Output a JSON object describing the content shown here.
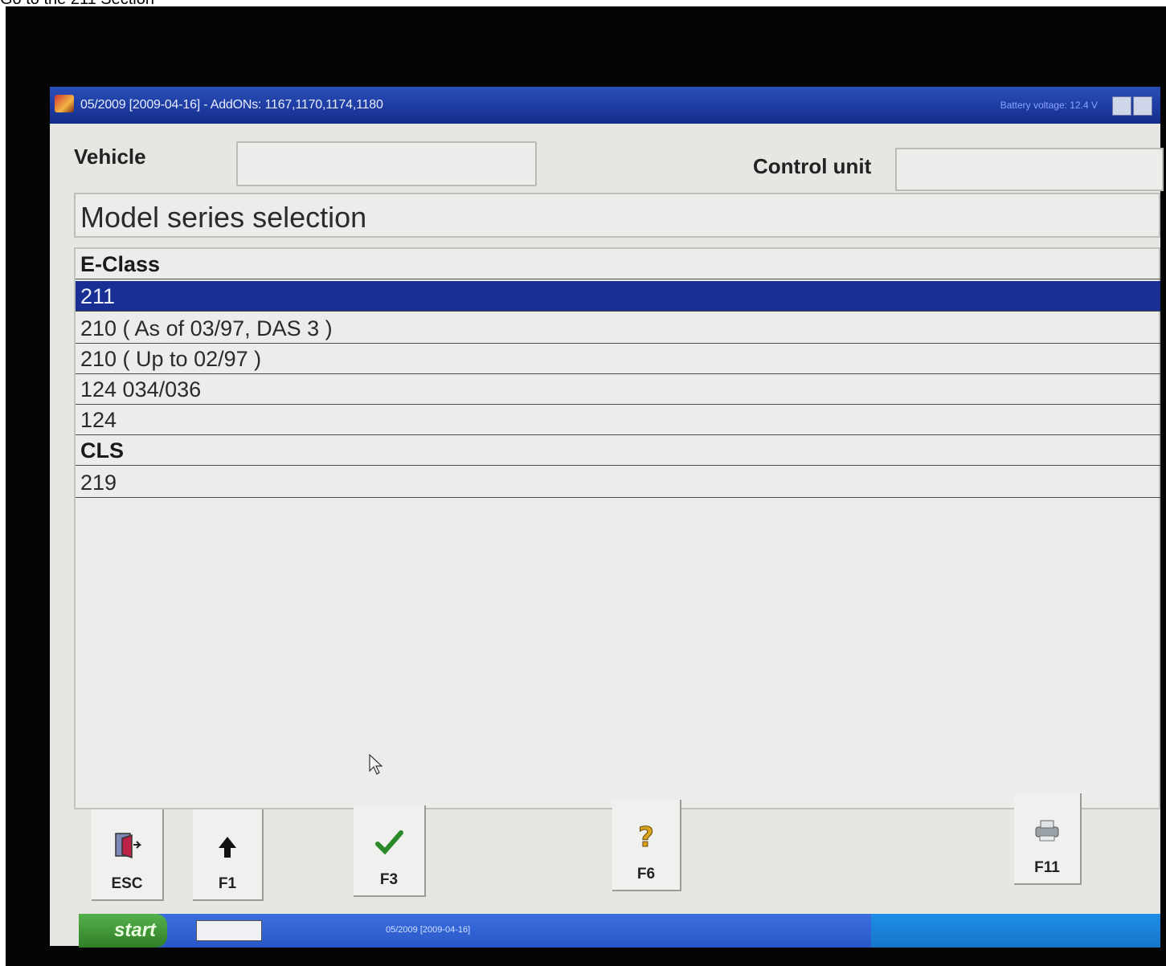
{
  "caption": "Go to the 211 Section",
  "window": {
    "title": "05/2009 [2009-04-16] - AddONs: 1167,1170,1174,1180",
    "battery_text": "Battery voltage: 12.4 V"
  },
  "header": {
    "vehicle_label": "Vehicle",
    "vehicle_value": "",
    "control_unit_label": "Control unit",
    "control_unit_value": ""
  },
  "section_title": "Model series selection",
  "list": {
    "rows": [
      {
        "label": "E-Class",
        "type": "group"
      },
      {
        "label": "211",
        "type": "item",
        "selected": true
      },
      {
        "label": "210 ( As of 03/97, DAS 3 )",
        "type": "item"
      },
      {
        "label": "210 ( Up to 02/97 )",
        "type": "item"
      },
      {
        "label": "124 034/036",
        "type": "item"
      },
      {
        "label": "124",
        "type": "item"
      },
      {
        "label": "CLS",
        "type": "group"
      },
      {
        "label": "219",
        "type": "item"
      }
    ]
  },
  "fkeys": {
    "esc": {
      "label": "ESC",
      "icon": "exit-door-icon"
    },
    "f1": {
      "label": "F1",
      "icon": "up-arrow-icon"
    },
    "f3": {
      "label": "F3",
      "icon": "checkmark-icon"
    },
    "f6": {
      "label": "F6",
      "icon": "help-question-icon"
    },
    "f11": {
      "label": "F11",
      "icon": "printer-icon"
    }
  },
  "taskbar": {
    "start_label": "start",
    "task_label": "05/2009 [2009-04-16]"
  },
  "colors": {
    "titlebar": "#1c3aa0",
    "selection": "#1a2f94",
    "checkmark": "#2a8a2a",
    "help": "#d9a21b"
  }
}
